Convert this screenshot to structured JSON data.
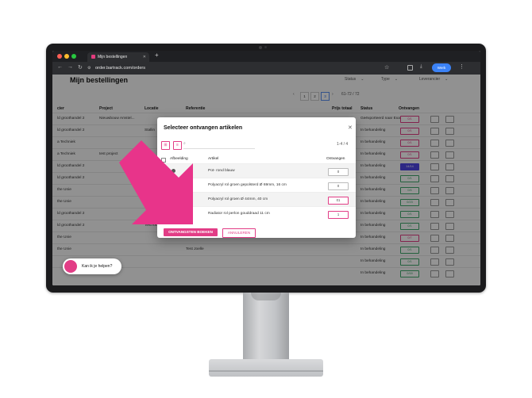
{
  "browser": {
    "tab_title": "Mijn bestellingen",
    "url": "order.bartrack.com/orders",
    "profile_label": "Werk"
  },
  "page": {
    "title": "Mijn bestellingen",
    "filters": [
      "Status",
      "Type",
      "Leverancier"
    ],
    "pagination": {
      "pages": [
        "1",
        "2",
        "3"
      ],
      "active": "3",
      "range": "61-72 / 72"
    }
  },
  "table": {
    "headers": [
      "cier",
      "Project",
      "Locatie",
      "Referentie",
      "Prijs totaal",
      "Status",
      "Ontvangen"
    ],
    "rows": [
      {
        "supplier": "ld groothandel 2",
        "project": "Nieuwbouw Amstel...",
        "location": "",
        "reference": "",
        "status": "Geëxporteerd naar Exact",
        "received": "0/1",
        "badge": "pink"
      },
      {
        "supplier": "ld groothandel 2",
        "project": "",
        "location": "Stallin",
        "reference": "",
        "status": "In behandeling",
        "received": "0/1",
        "badge": "pink"
      },
      {
        "supplier": "a Techniek",
        "project": "",
        "location": "",
        "reference": "",
        "status": "In behandeling",
        "received": "0/1",
        "badge": "pink"
      },
      {
        "supplier": "a Techniek",
        "project": "test project",
        "location": "",
        "reference": "",
        "status": "In behandeling",
        "received": "0/1",
        "badge": "pink"
      },
      {
        "supplier": "ld groothandel 2",
        "project": "",
        "location": "",
        "reference": "",
        "status": "In behandeling",
        "received": "14/14",
        "badge": "blue"
      },
      {
        "supplier": "ld groothandel 2",
        "project": "",
        "location": "",
        "reference": "",
        "status": "In behandeling",
        "received": "0/1",
        "badge": "green"
      },
      {
        "supplier": "the Unie",
        "project": "",
        "location": "Stal",
        "reference": "",
        "status": "In behandeling",
        "received": "0/4",
        "badge": "green"
      },
      {
        "supplier": "the Unie",
        "project": "",
        "location": "",
        "reference": "",
        "status": "In behandeling",
        "received": "0/23",
        "badge": "green"
      },
      {
        "supplier": "ld groothandel 2",
        "project": "",
        "location": "Werkp",
        "reference": "",
        "status": "In behandeling",
        "received": "0/1",
        "badge": "green"
      },
      {
        "supplier": "ld groothandel 2",
        "project": "",
        "location": "Test loc",
        "reference": "",
        "status": "In behandeling",
        "received": "0/1",
        "badge": "green"
      },
      {
        "supplier": "the Unie",
        "project": "",
        "location": "",
        "reference": "",
        "status": "In behandeling",
        "received": "0/7",
        "badge": "pink"
      },
      {
        "supplier": "the Unie",
        "project": "",
        "location": "",
        "reference": "Test Joelle",
        "status": "In behandeling",
        "received": "0/1",
        "badge": "green"
      },
      {
        "supplier": "",
        "project": "",
        "location": "",
        "reference": "",
        "status": "In behandeling",
        "received": "0/1",
        "badge": "green"
      },
      {
        "supplier": "",
        "project": "",
        "location": "",
        "reference": "",
        "status": "In behandeling",
        "received": "0/69",
        "badge": "green"
      }
    ]
  },
  "modal": {
    "title": "Selecteer ontvangen artikelen",
    "count": "1-4 / 4",
    "columns": {
      "image": "Afbeelding",
      "article": "Artikel",
      "received": "Ontvangen"
    },
    "items": [
      {
        "article": "Pot- rond blauw",
        "qty": "0",
        "shaded": true,
        "has_image": true
      },
      {
        "article": "Polyacryl rol groen gepolsterd Ø 69mm, 16 cm",
        "qty": "0",
        "shaded": false,
        "has_image": false
      },
      {
        "article": "Polyacryl rol groen Ø 44mm, 40 cm",
        "qty": "01",
        "shaded": true,
        "has_image": false
      },
      {
        "article": "Radiator rol perlon gouddraad 11 cm",
        "qty": "1",
        "shaded": false,
        "has_image": false
      }
    ],
    "primary_button": "ONTVANGSTEN BOEKEN",
    "secondary_button": "ANNULEREN"
  },
  "chat": {
    "text": "Kan ik je helpen?"
  },
  "colors": {
    "accent": "#e23d86",
    "arrow": "#e8348a",
    "success": "#3fa86b",
    "primary_blue": "#4f46e5"
  }
}
